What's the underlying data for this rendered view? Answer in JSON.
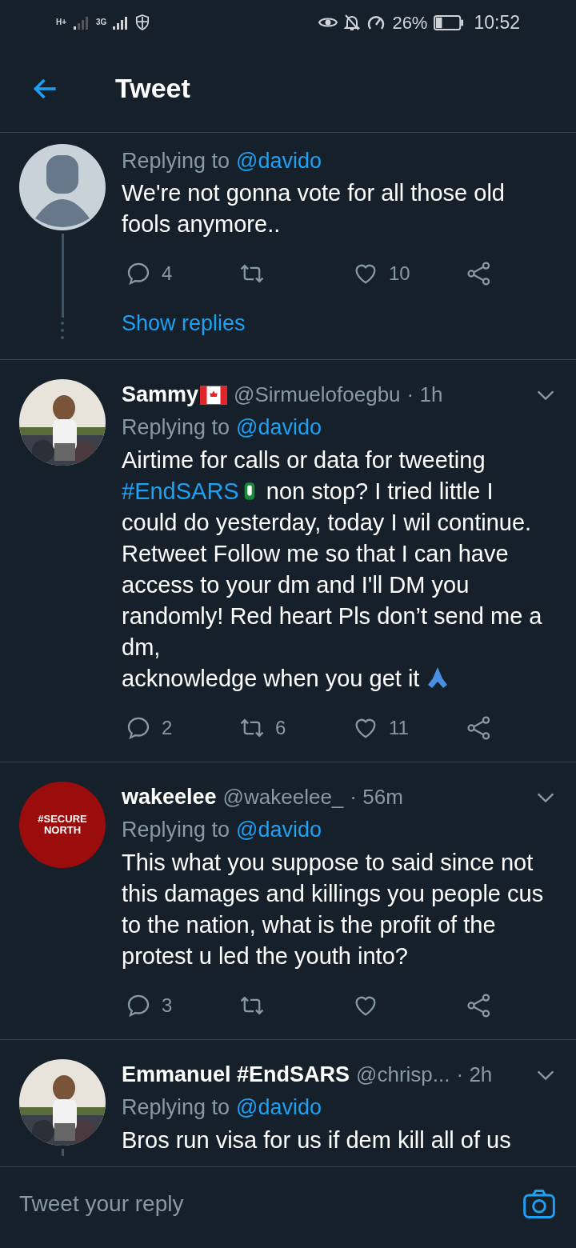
{
  "status_bar": {
    "battery_text": "26%",
    "time": "10:52",
    "network_1": "H+",
    "network_2": "3G"
  },
  "header": {
    "title": "Tweet"
  },
  "tweets": [
    {
      "avatar": {
        "kind": "default"
      },
      "reply_label": "Replying to",
      "reply_to": "@davido",
      "body": [
        {
          "kind": "text",
          "text": "We're not gonna vote for all those old fools anymore.."
        }
      ],
      "replies": "4",
      "likes": "10",
      "thread_line": true,
      "show_replies": "Show replies"
    },
    {
      "name": "Sammy",
      "flag": true,
      "handle": "@Sirmuelofoegbu",
      "time": "· 1h",
      "reply_label": "Replying to",
      "reply_to": "@davido",
      "body": [
        {
          "kind": "text",
          "text": "Airtime for calls or data for tweeting "
        },
        {
          "kind": "hashtag",
          "text": "#EndSARS"
        },
        {
          "kind": "fist"
        },
        {
          "kind": "text",
          "text": "  non stop? I tried little I could do yesterday, today I wil continue. Retweet Follow me so that I can have access to your dm and I'll DM you randomly!  Red heart Pls don’t send me a dm,\nacknowledge when you get it "
        },
        {
          "kind": "pray"
        }
      ],
      "replies": "2",
      "retweets": "6",
      "likes": "11",
      "thread_line": false
    },
    {
      "avatar": {
        "kind": "logo",
        "text": "#SECURE NORTH"
      },
      "name": "wakeelee",
      "handle": "@wakeelee_",
      "time": "· 56m",
      "reply_label": "Replying to",
      "reply_to": "@davido",
      "body": [
        {
          "kind": "text",
          "text": "This what you suppose to said since not this damages and killings you people cus to the nation, what is the profit of the protest u led the youth into?"
        }
      ],
      "replies": "3",
      "thread_line": false
    },
    {
      "name": "Emmanuel #EndSARS",
      "handle": "@chrisp...",
      "time": "· 2h",
      "reply_label": "Replying to",
      "reply_to": "@davido",
      "body": [
        {
          "kind": "text",
          "text": "Bros run visa for us if dem kill all of us"
        }
      ],
      "thread_line": true
    }
  ],
  "reply_bar": {
    "placeholder": "Tweet your reply"
  }
}
